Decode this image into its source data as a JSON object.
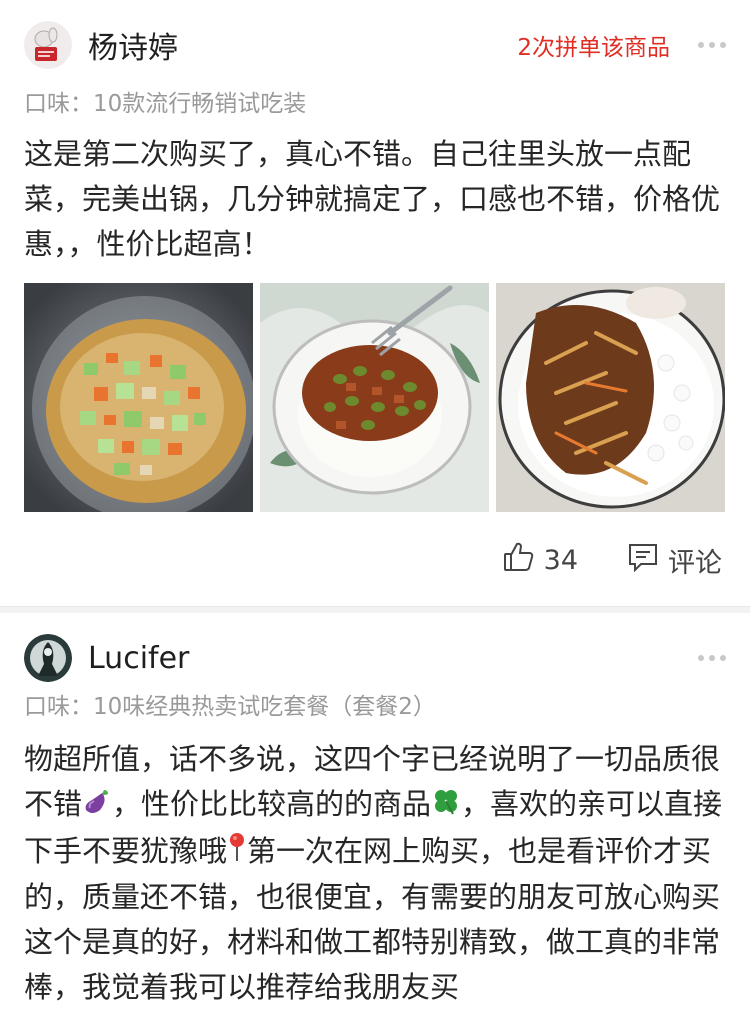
{
  "reviews": [
    {
      "username": "杨诗婷",
      "badge": "2次拼单该商品",
      "flavor": "口味：10款流行畅销试吃装",
      "text": "这是第二次购买了，真心不错。自己往里头放一点配菜，完美出锅，几分钟就搞定了，口感也不错，价格优惠，，性价比超高！",
      "likes": "34",
      "comment_label": "评论",
      "icons": [
        "thumbs-up-icon",
        "comment-icon",
        "more-icon"
      ]
    },
    {
      "username": "Lucifer",
      "flavor": "口味：10味经典热卖试吃套餐（套餐2）",
      "text_parts": [
        "物超所值，话不多说，这四个字已经说明了一切品质很不错",
        "，性价比比较高的的商品",
        "，喜欢的亲可以直接下手不要犹豫哦",
        "第一次在网上购买，也是看评价才买的，质量还不错，也很便宜，有需要的朋友可放心购买这个是真的好，材料和做工都特别精致，做工真的非常棒，我觉着我可以推荐给我朋友买"
      ],
      "emojis": [
        "eggplant-emoji",
        "four-leaf-clover-emoji",
        "pushpin-emoji"
      ]
    }
  ],
  "colors": {
    "badge": "#e02e24",
    "muted": "#9a9a9a",
    "divider": "#f2f2f2"
  }
}
